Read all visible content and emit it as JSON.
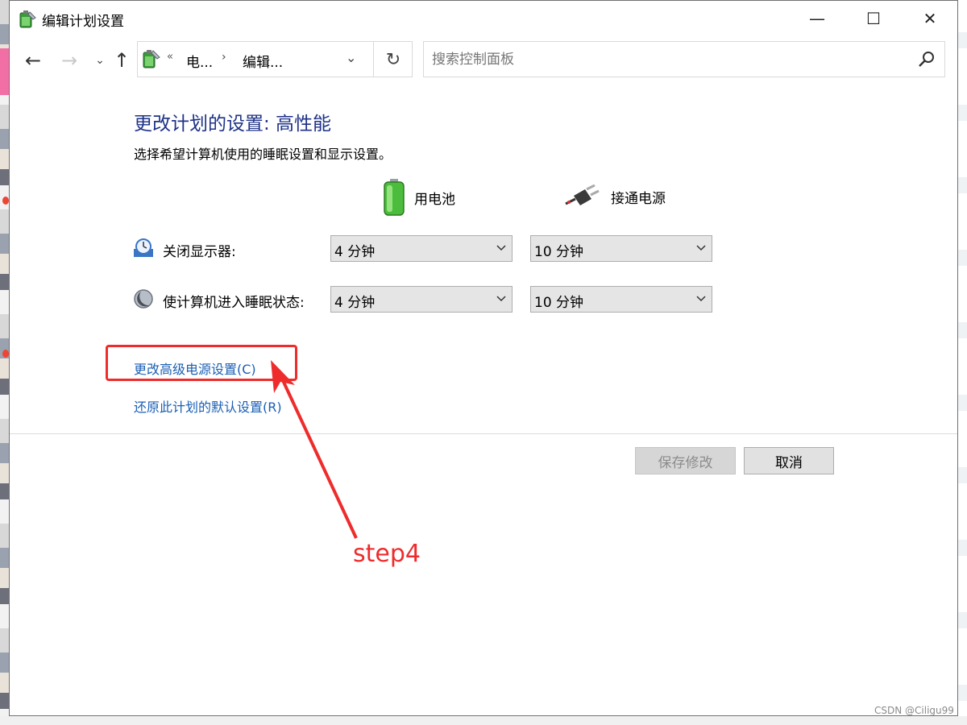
{
  "window": {
    "title": "编辑计划设置",
    "controls": {
      "minimize": "—",
      "maximize": "☐",
      "close": "✕"
    }
  },
  "nav": {
    "address_overflow": "«",
    "breadcrumbs": [
      "电...",
      "编辑..."
    ],
    "search_placeholder": "搜索控制面板"
  },
  "content": {
    "heading": "更改计划的设置: 高性能",
    "subtitle": "选择希望计算机使用的睡眠设置和显示设置。",
    "columns": {
      "battery": "用电池",
      "plugged": "接通电源"
    },
    "rows": [
      {
        "label": "关闭显示器:",
        "battery": "4 分钟",
        "plugged": "10 分钟"
      },
      {
        "label": "使计算机进入睡眠状态:",
        "battery": "4 分钟",
        "plugged": "10 分钟"
      }
    ],
    "links": {
      "advanced": "更改高级电源设置(C)",
      "restore": "还原此计划的默认设置(R)"
    },
    "buttons": {
      "save": "保存修改",
      "cancel": "取消"
    }
  },
  "annotation": {
    "step_label": "step4",
    "color": "#ee2c2c"
  },
  "watermark": "CSDN @Ciligu99"
}
